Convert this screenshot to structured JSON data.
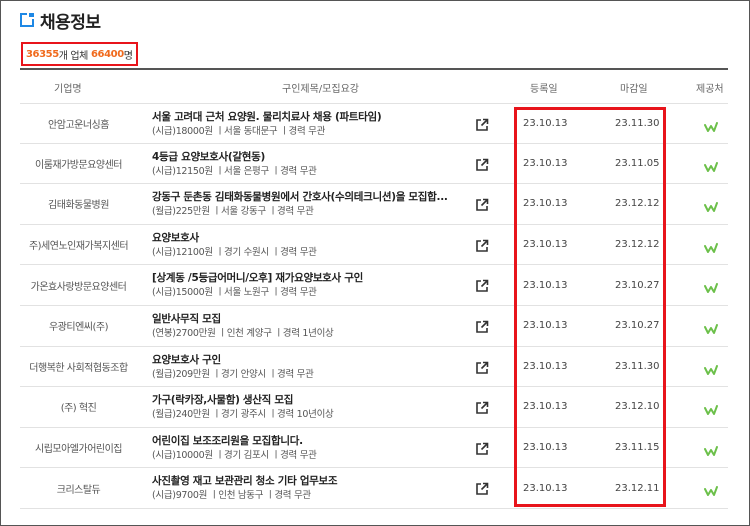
{
  "header": {
    "title": "채용정보"
  },
  "summary": {
    "count": "36355",
    "count_suffix": "개 업체",
    "people": "66400",
    "people_suffix": "명"
  },
  "table": {
    "columns": [
      "기업명",
      "구인제목/모집요강",
      "등록일",
      "마감일",
      "제공처"
    ],
    "rows": [
      {
        "company": "안암고운너싱홈",
        "title": "서울 고려대 근처 요양원. 물리치료사 채용 (파트타임)",
        "meta": "(시급)18000원 ㅣ서울 동대문구 ㅣ경력 무관",
        "reg": "23.10.13",
        "due": "23.11.30"
      },
      {
        "company": "이룸재가방문요양센터",
        "title": "4등급 요양보호사(갈현동)",
        "meta": "(시급)12150원 ㅣ서울 은평구 ㅣ경력 무관",
        "reg": "23.10.13",
        "due": "23.11.05"
      },
      {
        "company": "김태화동물병원",
        "title": "강동구 둔촌동 김태화동물병원에서 간호사(수의테크니션)을 모집합...",
        "meta": "(월급)225만원 ㅣ서울 강동구 ㅣ경력 무관",
        "reg": "23.10.13",
        "due": "23.12.12"
      },
      {
        "company": "주)세연노인재가복지센터",
        "title": "요양보호사",
        "meta": "(시급)12100원 ㅣ경기 수원시 ㅣ경력 무관",
        "reg": "23.10.13",
        "due": "23.12.12"
      },
      {
        "company": "가온효사랑방문요양센터",
        "title": "[상계동 /5등급어머니/오후] 재가요양보호사 구인",
        "meta": "(시급)15000원 ㅣ서울 노원구 ㅣ경력 무관",
        "reg": "23.10.13",
        "due": "23.10.27"
      },
      {
        "company": "우광티엔씨(주)",
        "title": "일반사무직 모집",
        "meta": "(연봉)2700만원 ㅣ인천 계양구 ㅣ경력 1년이상",
        "reg": "23.10.13",
        "due": "23.10.27"
      },
      {
        "company": "더행복한 사회적협동조합",
        "title": "요양보호사 구인",
        "meta": "(월급)209만원 ㅣ경기 안양시 ㅣ경력 무관",
        "reg": "23.10.13",
        "due": "23.11.30"
      },
      {
        "company": "(주) 혁진",
        "title": "가구(락카장,사물함) 생산직 모집",
        "meta": "(월급)240만원 ㅣ경기 광주시 ㅣ경력 10년이상",
        "reg": "23.10.13",
        "due": "23.12.10"
      },
      {
        "company": "시립모아엘가어린이집",
        "title": "어린이집 보조조리원을 모집합니다.",
        "meta": "(시급)10000원 ㅣ경기 김포시 ㅣ경력 무관",
        "reg": "23.10.13",
        "due": "23.11.15"
      },
      {
        "company": "크리스탈듀",
        "title": "사진촬영 재고 보관관리 청소 기타 업무보조",
        "meta": "(시급)9700원 ㅣ인천 남동구 ㅣ경력 무관",
        "reg": "23.10.13",
        "due": "23.12.11"
      }
    ]
  },
  "colors": {
    "accent": "#1e88e5",
    "highlight": "#e8141b",
    "count": "#f06a1d",
    "provider": "#6cc04a"
  },
  "icons": {
    "title": "window-icon",
    "link": "external-link-icon",
    "provider": "worknet-logo-icon"
  }
}
